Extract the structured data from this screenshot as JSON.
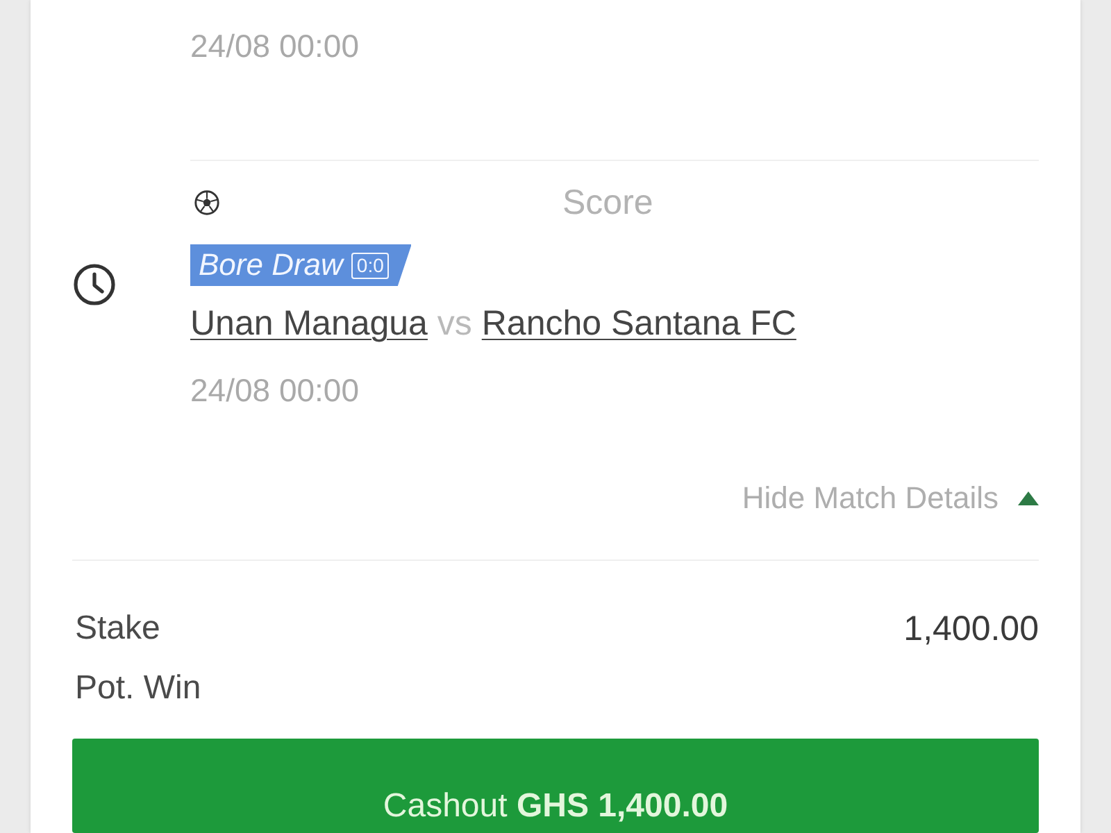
{
  "match_items": [
    {
      "kind": "partial",
      "date": "24/08 00:00"
    },
    {
      "kind": "selection",
      "market": "Score",
      "tag": {
        "label": "Bore Draw",
        "score": "0:0"
      },
      "home": "Unan Managua",
      "separator": "vs",
      "away": "Rancho Santana FC",
      "date": "24/08 00:00"
    }
  ],
  "details_toggle": {
    "label": "Hide Match Details",
    "expanded": true
  },
  "summary": [
    {
      "label": "Stake",
      "value": "1,400.00"
    },
    {
      "label": "Pot. Win"
    }
  ],
  "cashout_button": {
    "label": "Cashout **GHS 1,400.00**"
  }
}
